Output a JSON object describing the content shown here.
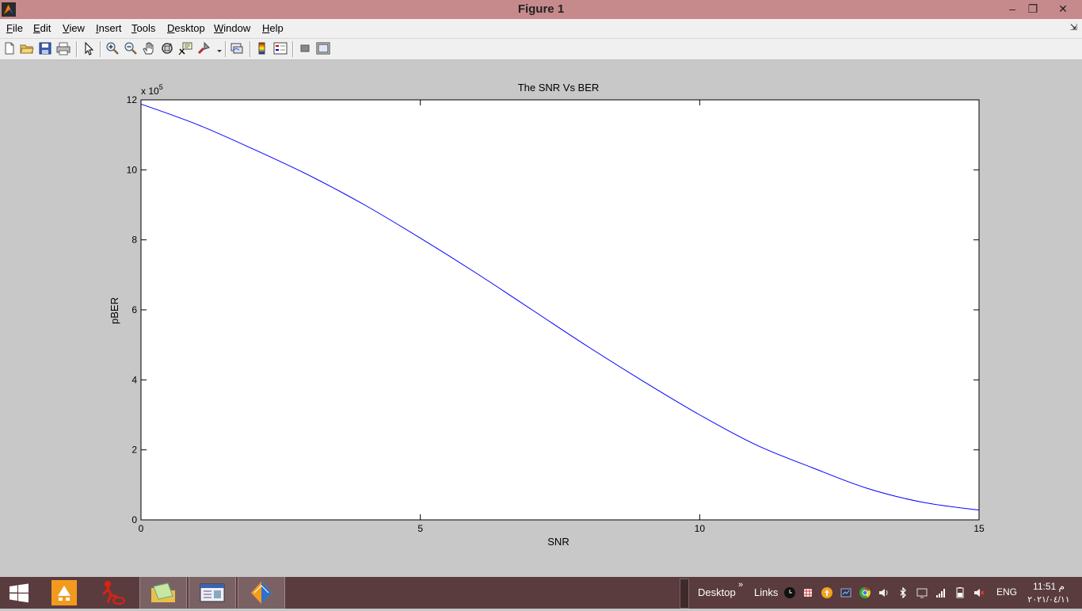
{
  "window": {
    "title": "Figure 1",
    "minimize_glyph": "–",
    "maximize_glyph": "❐",
    "close_glyph": "✕"
  },
  "menu": {
    "items": [
      {
        "label": "File",
        "underline": "F",
        "rest": "ile"
      },
      {
        "label": "Edit",
        "underline": "E",
        "rest": "dit"
      },
      {
        "label": "View",
        "underline": "V",
        "rest": "iew"
      },
      {
        "label": "Insert",
        "underline": "I",
        "rest": "nsert"
      },
      {
        "label": "Tools",
        "underline": "T",
        "rest": "ools"
      },
      {
        "label": "Desktop",
        "underline": "D",
        "rest": "esktop"
      },
      {
        "label": "Window",
        "underline": "W",
        "rest": "indow"
      },
      {
        "label": "Help",
        "underline": "H",
        "rest": "elp"
      }
    ]
  },
  "toolbar": {
    "icons": [
      "new-figure-icon",
      "open-file-icon",
      "save-icon",
      "print-icon",
      "edit-plot-icon",
      "zoom-in-icon",
      "zoom-out-icon",
      "pan-icon",
      "rotate-3d-icon",
      "data-cursor-icon",
      "brush-icon",
      "link-plot-icon",
      "colorbar-icon",
      "legend-icon",
      "hide-plot-tools-icon",
      "show-plot-tools-icon"
    ]
  },
  "chart_data": {
    "type": "line",
    "title": "The SNR Vs BER",
    "xlabel": "SNR",
    "ylabel": "pBER",
    "y_exponent_label": "x 10",
    "y_exponent_power": "5",
    "xlim": [
      0,
      15
    ],
    "ylim": [
      0,
      12
    ],
    "x_ticks": [
      "0",
      "5",
      "10",
      "15"
    ],
    "y_ticks": [
      "0",
      "2",
      "4",
      "6",
      "8",
      "10",
      "12"
    ],
    "grid": false,
    "series": [
      {
        "color": "#0000ff",
        "x": [
          0,
          1,
          2,
          3,
          4,
          5,
          6,
          7,
          8,
          9,
          10,
          11,
          12,
          13,
          14,
          15
        ],
        "y": [
          11.88,
          11.3,
          10.6,
          9.85,
          9.0,
          8.05,
          7.05,
          6.0,
          4.95,
          3.95,
          3.0,
          2.15,
          1.5,
          0.9,
          0.5,
          0.28
        ]
      }
    ]
  },
  "taskbar": {
    "desktop_label": "Desktop",
    "links_label": "Links",
    "chevron": "»",
    "lang": "ENG",
    "time": "11:51 م",
    "date": "٢٠٢١/٠٤/١١"
  }
}
